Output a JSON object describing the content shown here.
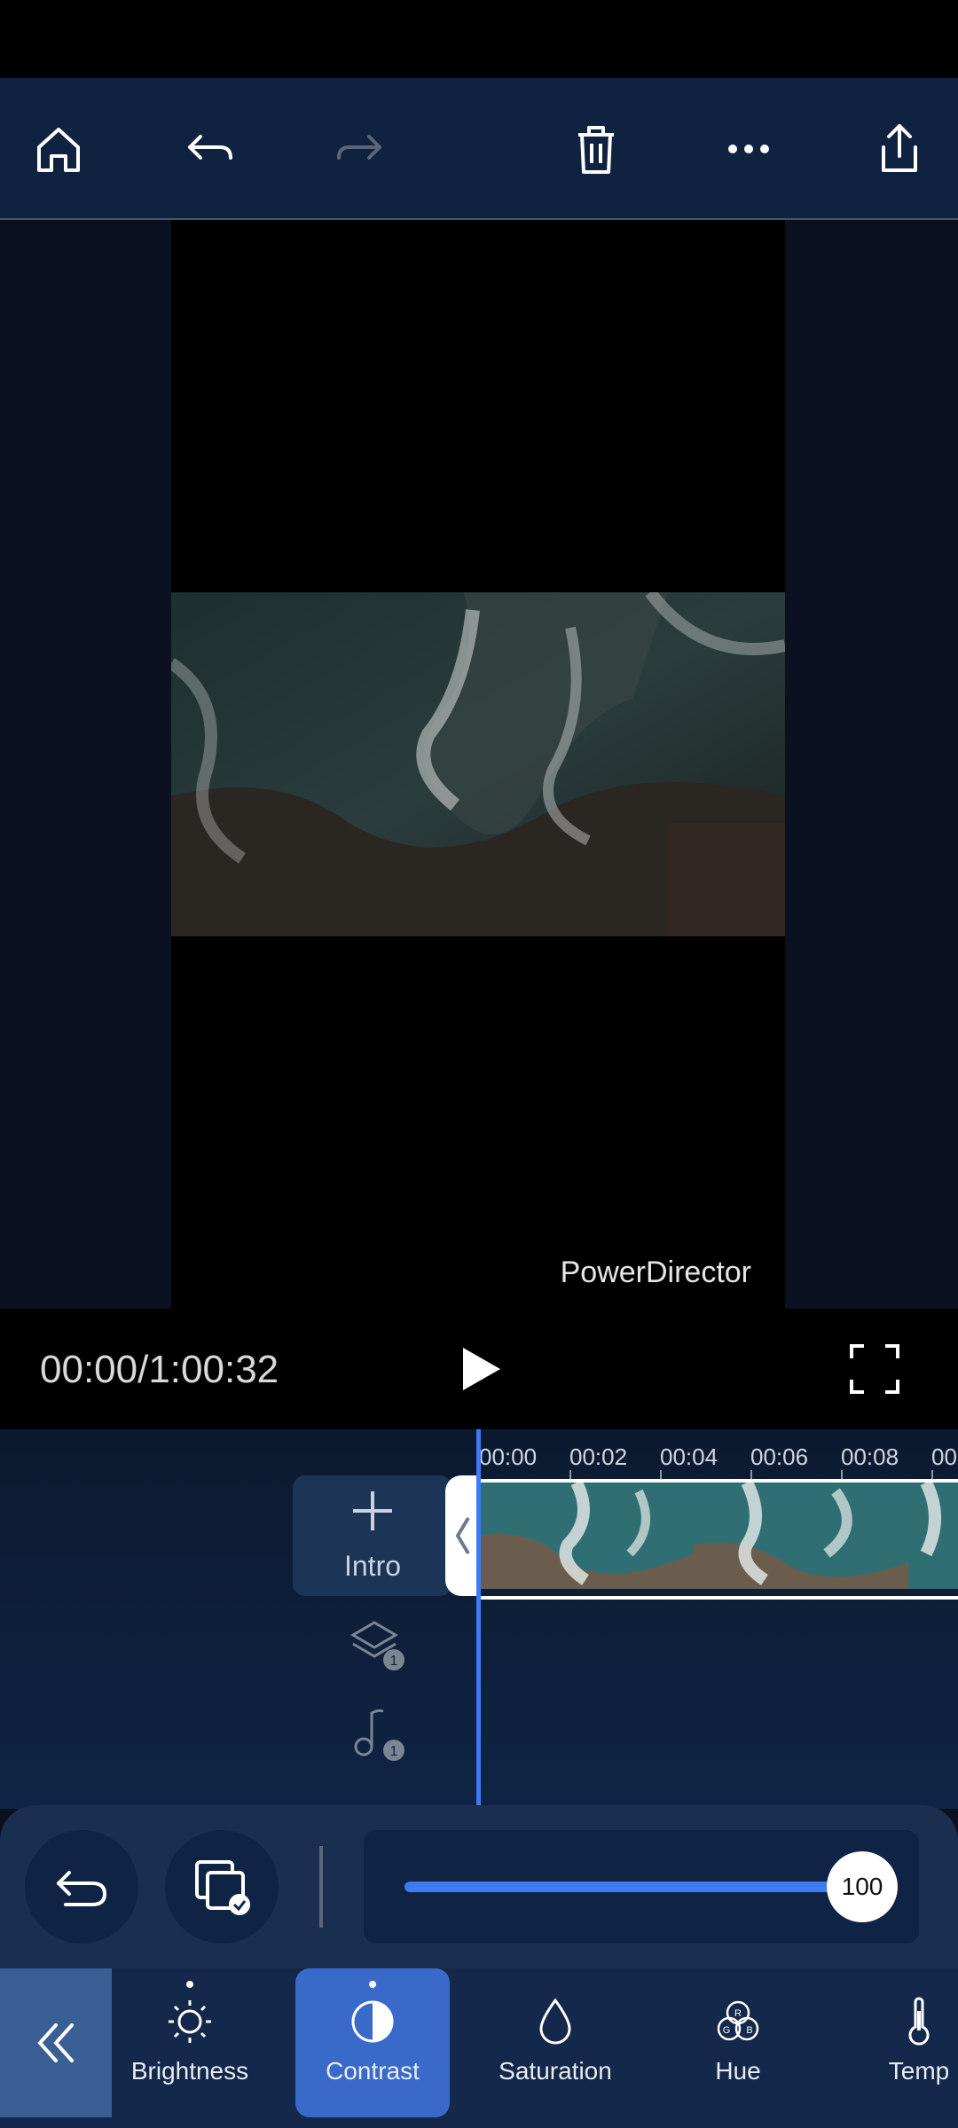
{
  "app": {
    "watermark": "PowerDirector"
  },
  "toolbar": {
    "buttons": [
      "home-icon",
      "undo-icon",
      "redo-icon",
      "delete-icon",
      "more-icon",
      "export-icon"
    ]
  },
  "playback": {
    "timecode": "00:00/1:00:32"
  },
  "timeline": {
    "ticks": [
      "00:00",
      "00:02",
      "00:04",
      "00:06",
      "00:08",
      "00"
    ],
    "intro_label": "Intro",
    "layer_badge": "1",
    "music_badge": "1"
  },
  "adjust": {
    "value": 100,
    "value_label": "100"
  },
  "tabs": [
    {
      "label": "Brightness",
      "icon": "sun-icon",
      "active": false
    },
    {
      "label": "Contrast",
      "icon": "contrast-icon",
      "active": true
    },
    {
      "label": "Saturation",
      "icon": "drop-icon",
      "active": false
    },
    {
      "label": "Hue",
      "icon": "rgb-icon",
      "active": false
    },
    {
      "label": "Temp",
      "icon": "thermometer-icon",
      "active": false
    }
  ],
  "colors": {
    "accent": "#3d7bf2",
    "toolbar_bg": "#0f2340",
    "active_tab": "#3a6ac9"
  }
}
